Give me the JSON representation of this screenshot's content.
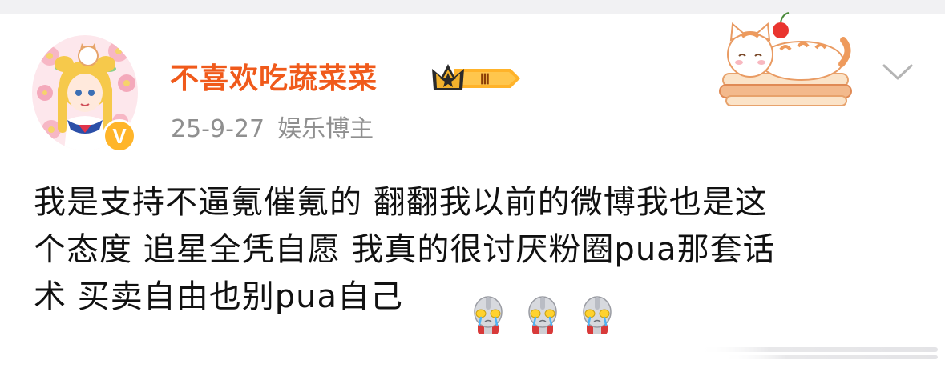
{
  "post": {
    "user": {
      "name": "不喜欢吃蔬菜菜",
      "verified_badge": "V",
      "level_badge": "Ⅲ",
      "avatar_icon": "sailor-moon-avatar-icon",
      "crown_icon": "crown-icon"
    },
    "meta": {
      "date": "25-9-27",
      "category": "娱乐博主"
    },
    "text_line1": "我是支持不逼氪催氪的 翻翻我以前的微博我也是这",
    "text_line2": "个态度 追星全凭自愿 我真的很讨厌粉圈pua那套话",
    "text_line3": "术 买卖自由也别pua自己",
    "emojis": [
      "ultraman-crying-icon",
      "ultraman-crying-icon",
      "ultraman-crying-icon"
    ],
    "sticker": "cat-on-cake-sticker",
    "menu_icon": "chevron-down-icon"
  },
  "colors": {
    "username": "#f05a1b",
    "meta": "#8f8f8f",
    "text": "#111111",
    "verified": "#ffb52a",
    "level_badge": "#ffb32a"
  }
}
